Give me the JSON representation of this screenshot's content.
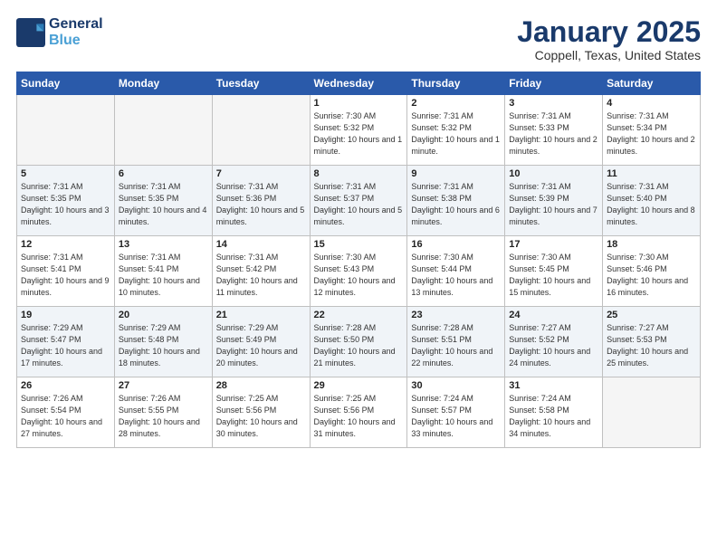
{
  "logo": {
    "line1": "General",
    "line2": "Blue"
  },
  "title": "January 2025",
  "subtitle": "Coppell, Texas, United States",
  "weekdays": [
    "Sunday",
    "Monday",
    "Tuesday",
    "Wednesday",
    "Thursday",
    "Friday",
    "Saturday"
  ],
  "weeks": [
    [
      {
        "day": "",
        "sunrise": "",
        "sunset": "",
        "daylight": ""
      },
      {
        "day": "",
        "sunrise": "",
        "sunset": "",
        "daylight": ""
      },
      {
        "day": "",
        "sunrise": "",
        "sunset": "",
        "daylight": ""
      },
      {
        "day": "1",
        "sunrise": "Sunrise: 7:30 AM",
        "sunset": "Sunset: 5:32 PM",
        "daylight": "Daylight: 10 hours and 1 minute."
      },
      {
        "day": "2",
        "sunrise": "Sunrise: 7:31 AM",
        "sunset": "Sunset: 5:32 PM",
        "daylight": "Daylight: 10 hours and 1 minute."
      },
      {
        "day": "3",
        "sunrise": "Sunrise: 7:31 AM",
        "sunset": "Sunset: 5:33 PM",
        "daylight": "Daylight: 10 hours and 2 minutes."
      },
      {
        "day": "4",
        "sunrise": "Sunrise: 7:31 AM",
        "sunset": "Sunset: 5:34 PM",
        "daylight": "Daylight: 10 hours and 2 minutes."
      }
    ],
    [
      {
        "day": "5",
        "sunrise": "Sunrise: 7:31 AM",
        "sunset": "Sunset: 5:35 PM",
        "daylight": "Daylight: 10 hours and 3 minutes."
      },
      {
        "day": "6",
        "sunrise": "Sunrise: 7:31 AM",
        "sunset": "Sunset: 5:35 PM",
        "daylight": "Daylight: 10 hours and 4 minutes."
      },
      {
        "day": "7",
        "sunrise": "Sunrise: 7:31 AM",
        "sunset": "Sunset: 5:36 PM",
        "daylight": "Daylight: 10 hours and 5 minutes."
      },
      {
        "day": "8",
        "sunrise": "Sunrise: 7:31 AM",
        "sunset": "Sunset: 5:37 PM",
        "daylight": "Daylight: 10 hours and 5 minutes."
      },
      {
        "day": "9",
        "sunrise": "Sunrise: 7:31 AM",
        "sunset": "Sunset: 5:38 PM",
        "daylight": "Daylight: 10 hours and 6 minutes."
      },
      {
        "day": "10",
        "sunrise": "Sunrise: 7:31 AM",
        "sunset": "Sunset: 5:39 PM",
        "daylight": "Daylight: 10 hours and 7 minutes."
      },
      {
        "day": "11",
        "sunrise": "Sunrise: 7:31 AM",
        "sunset": "Sunset: 5:40 PM",
        "daylight": "Daylight: 10 hours and 8 minutes."
      }
    ],
    [
      {
        "day": "12",
        "sunrise": "Sunrise: 7:31 AM",
        "sunset": "Sunset: 5:41 PM",
        "daylight": "Daylight: 10 hours and 9 minutes."
      },
      {
        "day": "13",
        "sunrise": "Sunrise: 7:31 AM",
        "sunset": "Sunset: 5:41 PM",
        "daylight": "Daylight: 10 hours and 10 minutes."
      },
      {
        "day": "14",
        "sunrise": "Sunrise: 7:31 AM",
        "sunset": "Sunset: 5:42 PM",
        "daylight": "Daylight: 10 hours and 11 minutes."
      },
      {
        "day": "15",
        "sunrise": "Sunrise: 7:30 AM",
        "sunset": "Sunset: 5:43 PM",
        "daylight": "Daylight: 10 hours and 12 minutes."
      },
      {
        "day": "16",
        "sunrise": "Sunrise: 7:30 AM",
        "sunset": "Sunset: 5:44 PM",
        "daylight": "Daylight: 10 hours and 13 minutes."
      },
      {
        "day": "17",
        "sunrise": "Sunrise: 7:30 AM",
        "sunset": "Sunset: 5:45 PM",
        "daylight": "Daylight: 10 hours and 15 minutes."
      },
      {
        "day": "18",
        "sunrise": "Sunrise: 7:30 AM",
        "sunset": "Sunset: 5:46 PM",
        "daylight": "Daylight: 10 hours and 16 minutes."
      }
    ],
    [
      {
        "day": "19",
        "sunrise": "Sunrise: 7:29 AM",
        "sunset": "Sunset: 5:47 PM",
        "daylight": "Daylight: 10 hours and 17 minutes."
      },
      {
        "day": "20",
        "sunrise": "Sunrise: 7:29 AM",
        "sunset": "Sunset: 5:48 PM",
        "daylight": "Daylight: 10 hours and 18 minutes."
      },
      {
        "day": "21",
        "sunrise": "Sunrise: 7:29 AM",
        "sunset": "Sunset: 5:49 PM",
        "daylight": "Daylight: 10 hours and 20 minutes."
      },
      {
        "day": "22",
        "sunrise": "Sunrise: 7:28 AM",
        "sunset": "Sunset: 5:50 PM",
        "daylight": "Daylight: 10 hours and 21 minutes."
      },
      {
        "day": "23",
        "sunrise": "Sunrise: 7:28 AM",
        "sunset": "Sunset: 5:51 PM",
        "daylight": "Daylight: 10 hours and 22 minutes."
      },
      {
        "day": "24",
        "sunrise": "Sunrise: 7:27 AM",
        "sunset": "Sunset: 5:52 PM",
        "daylight": "Daylight: 10 hours and 24 minutes."
      },
      {
        "day": "25",
        "sunrise": "Sunrise: 7:27 AM",
        "sunset": "Sunset: 5:53 PM",
        "daylight": "Daylight: 10 hours and 25 minutes."
      }
    ],
    [
      {
        "day": "26",
        "sunrise": "Sunrise: 7:26 AM",
        "sunset": "Sunset: 5:54 PM",
        "daylight": "Daylight: 10 hours and 27 minutes."
      },
      {
        "day": "27",
        "sunrise": "Sunrise: 7:26 AM",
        "sunset": "Sunset: 5:55 PM",
        "daylight": "Daylight: 10 hours and 28 minutes."
      },
      {
        "day": "28",
        "sunrise": "Sunrise: 7:25 AM",
        "sunset": "Sunset: 5:56 PM",
        "daylight": "Daylight: 10 hours and 30 minutes."
      },
      {
        "day": "29",
        "sunrise": "Sunrise: 7:25 AM",
        "sunset": "Sunset: 5:56 PM",
        "daylight": "Daylight: 10 hours and 31 minutes."
      },
      {
        "day": "30",
        "sunrise": "Sunrise: 7:24 AM",
        "sunset": "Sunset: 5:57 PM",
        "daylight": "Daylight: 10 hours and 33 minutes."
      },
      {
        "day": "31",
        "sunrise": "Sunrise: 7:24 AM",
        "sunset": "Sunset: 5:58 PM",
        "daylight": "Daylight: 10 hours and 34 minutes."
      },
      {
        "day": "",
        "sunrise": "",
        "sunset": "",
        "daylight": ""
      }
    ]
  ]
}
